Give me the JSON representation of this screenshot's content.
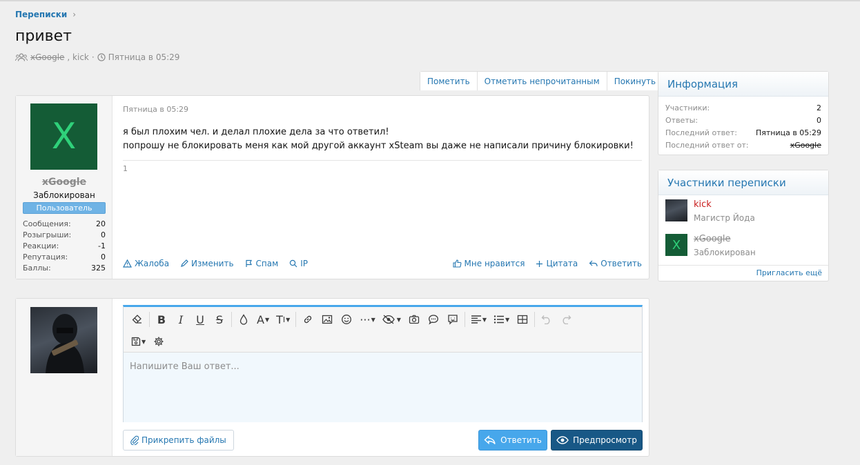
{
  "breadcrumb": {
    "label": "Переписки",
    "chevron": "›"
  },
  "page": {
    "title": "привет",
    "meta": {
      "participant1": "xGoogle",
      "participant2": ", kick",
      "separator": "·",
      "date": "Пятница в 05:29"
    }
  },
  "actions": {
    "mark": "Пометить",
    "mark_unread": "Отметить непрочитанным",
    "leave": "Покинуть"
  },
  "message": {
    "author": {
      "name": "xGoogle",
      "title": "Заблокирован",
      "badge": "Пользователь",
      "avatar_letter": "X",
      "stats": [
        {
          "label": "Сообщения:",
          "value": "20"
        },
        {
          "label": "Розыгрыши:",
          "value": "0"
        },
        {
          "label": "Реакции:",
          "value": "-1"
        },
        {
          "label": "Репутация:",
          "value": "0"
        },
        {
          "label": "Баллы:",
          "value": "325"
        }
      ]
    },
    "date": "Пятница в 05:29",
    "line1": "я был плохим чел. и делал плохие дела за что ответил!",
    "line2": "попрошу не блокировать меня как мой другой аккаунт xSteam вы даже не написали причину блокировки!",
    "extra": "1",
    "actions_left": {
      "report": "Жалоба",
      "edit": "Изменить",
      "spam": "Спам",
      "ip": "IP"
    },
    "actions_right": {
      "like": "Мне нравится",
      "quote": "Цитата",
      "reply": "Ответить"
    }
  },
  "reply": {
    "placeholder": "Напишите Ваш ответ...",
    "attach": "Прикрепить файлы",
    "submit": "Ответить",
    "preview": "Предпросмотр"
  },
  "info": {
    "title": "Информация",
    "rows": [
      {
        "label": "Участники:",
        "value": "2"
      },
      {
        "label": "Ответы:",
        "value": "0"
      },
      {
        "label": "Последний ответ:",
        "value": "Пятница в 05:29"
      },
      {
        "label": "Последний ответ от:",
        "value": "xGoogle"
      }
    ]
  },
  "participants": {
    "title": "Участники переписки",
    "list": [
      {
        "name": "kick",
        "role": "Магистр Йода"
      },
      {
        "name": "xGoogle",
        "role": "Заблокирован",
        "avatar_letter": "X"
      }
    ],
    "invite": "Пригласить ещё"
  },
  "colors": {
    "link": "#2577b1",
    "accent": "#47a7eb",
    "primary_button": "#185886",
    "banned_avatar": "#145c36"
  }
}
